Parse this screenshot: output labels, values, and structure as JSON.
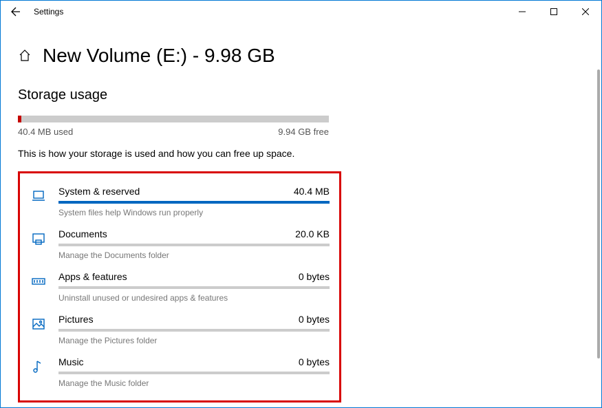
{
  "window": {
    "title": "Settings"
  },
  "page": {
    "title": "New Volume (E:) - 9.98 GB",
    "section_title": "Storage usage",
    "used_label": "40.4 MB used",
    "free_label": "9.94 GB free",
    "description": "This is how your storage is used and how you can free up space.",
    "overall_fill_pct": "1%"
  },
  "categories": [
    {
      "name": "System & reserved",
      "size": "40.4 MB",
      "subtext": "System files help Windows run properly",
      "fill_pct": "100%",
      "icon": "laptop"
    },
    {
      "name": "Documents",
      "size": "20.0 KB",
      "subtext": "Manage the Documents folder",
      "fill_pct": "0%",
      "icon": "document"
    },
    {
      "name": "Apps & features",
      "size": "0 bytes",
      "subtext": "Uninstall unused or undesired apps & features",
      "fill_pct": "0%",
      "icon": "apps"
    },
    {
      "name": "Pictures",
      "size": "0 bytes",
      "subtext": "Manage the Pictures folder",
      "fill_pct": "0%",
      "icon": "pictures"
    },
    {
      "name": "Music",
      "size": "0 bytes",
      "subtext": "Manage the Music folder",
      "fill_pct": "0%",
      "icon": "music"
    }
  ]
}
